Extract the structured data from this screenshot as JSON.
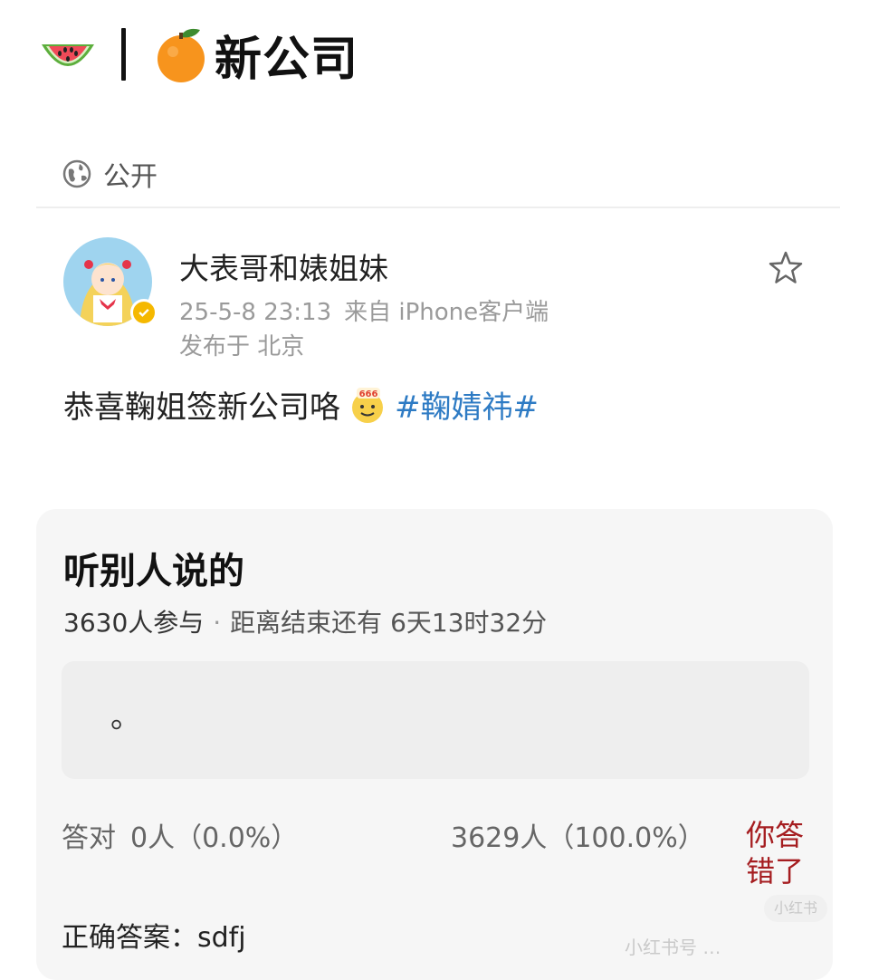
{
  "header": {
    "title": "新公司",
    "icons": [
      "watermelon-icon",
      "orange-icon"
    ]
  },
  "visibility": {
    "label": "公开",
    "icon": "globe-icon"
  },
  "post": {
    "author": "大表哥和婊姐妹",
    "timestamp": "25-5-8 23:13",
    "source": "来自 iPhone客户端",
    "location": "发布于 北京",
    "text": "恭喜鞠姐签新公司咯",
    "hashtag": "#鞠婧祎#",
    "sticker": "666",
    "favorite_icon": "star-icon"
  },
  "poll": {
    "title": "听别人说的",
    "participants": "3630人参与",
    "remaining": "距离结束还有 6天13时32分",
    "option_text": "。",
    "correct_label": "答对",
    "correct_stat": "0人（0.0%）",
    "wrong_stat": "3629人（100.0%）",
    "result": "你答错了",
    "answer": "正确答案：sdfj"
  },
  "watermark": {
    "logo": "小红书",
    "text": "小红书号 …"
  },
  "colors": {
    "hashtag": "#2e7bc4",
    "wrong": "#a51d20",
    "card_bg": "#f6f6f6",
    "verified": "#f5b800"
  }
}
